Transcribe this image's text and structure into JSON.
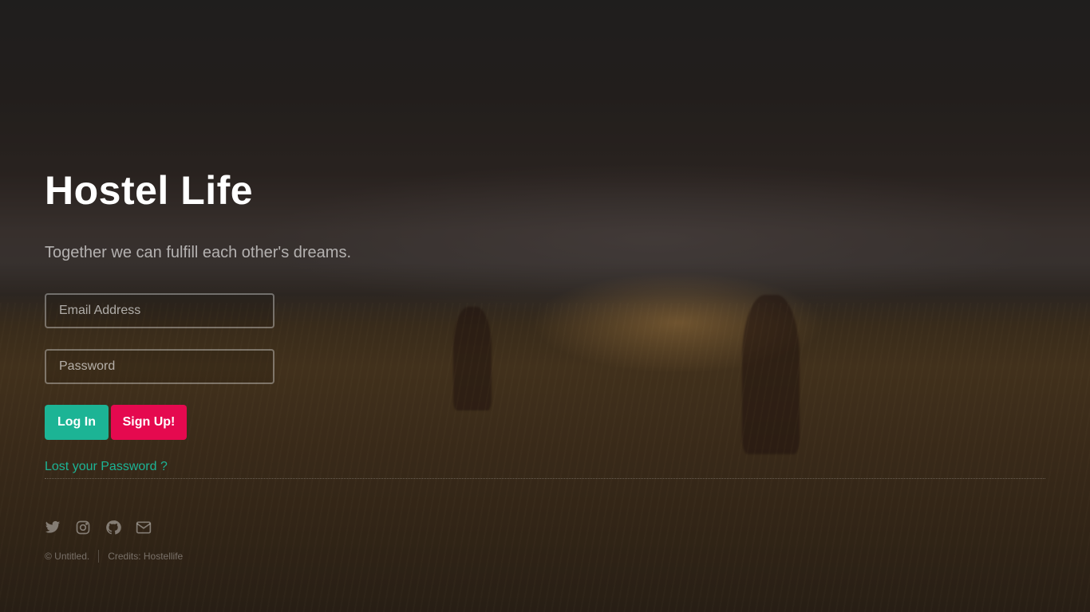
{
  "header": {
    "title": "Hostel Life",
    "tagline": "Together we can fulfill each other's dreams."
  },
  "form": {
    "email_placeholder": "Email Address",
    "password_placeholder": "Password",
    "login_label": "Log In",
    "signup_label": "Sign Up!",
    "lost_password_label": "Lost your Password ?"
  },
  "social": {
    "icons": [
      "twitter-icon",
      "instagram-icon",
      "github-icon",
      "envelope-icon"
    ]
  },
  "footer": {
    "copyright": "© Untitled.",
    "credits": "Credits: Hostellife"
  },
  "colors": {
    "accent": "#1cb495",
    "signup": "#e5094f"
  }
}
